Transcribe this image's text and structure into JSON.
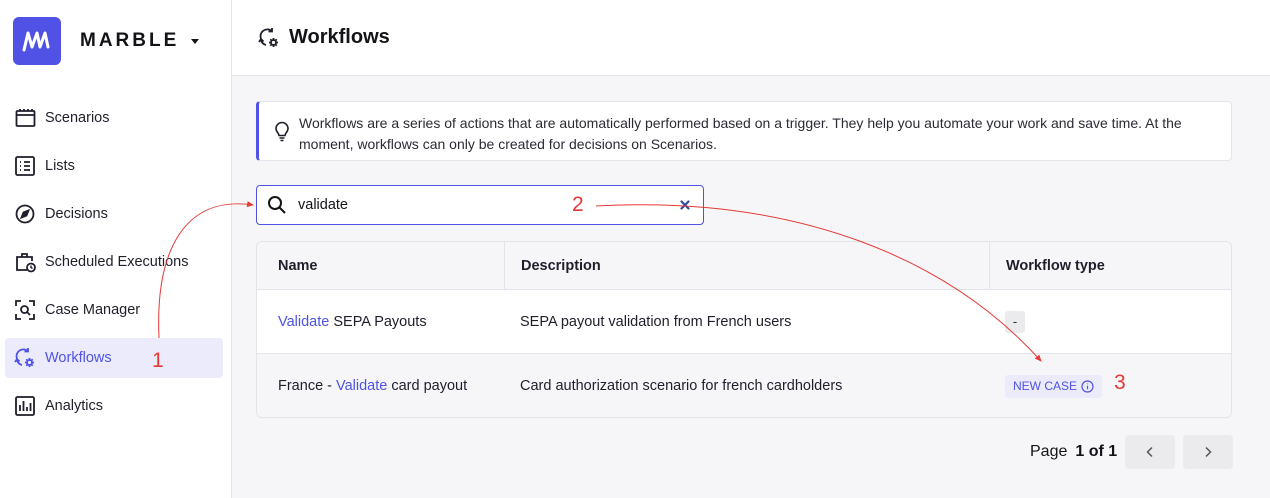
{
  "brand": {
    "name": "MARBLE"
  },
  "sidebar": {
    "items": [
      {
        "label": "Scenarios",
        "icon": "scenarios-icon"
      },
      {
        "label": "Lists",
        "icon": "list-icon"
      },
      {
        "label": "Decisions",
        "icon": "compass-icon"
      },
      {
        "label": "Scheduled Executions",
        "icon": "scheduled-icon"
      },
      {
        "label": "Case Manager",
        "icon": "case-manager-icon"
      },
      {
        "label": "Workflows",
        "icon": "workflow-icon",
        "active": true
      },
      {
        "label": "Analytics",
        "icon": "analytics-icon"
      }
    ]
  },
  "header": {
    "title": "Workflows",
    "icon": "workflow-icon"
  },
  "callout": {
    "text": "Workflows are a series of actions that are automatically performed based on a trigger. They help you automate your work and save time. At the moment, workflows can only be created for decisions on Scenarios."
  },
  "search": {
    "value": "validate"
  },
  "table": {
    "headers": {
      "name": "Name",
      "description": "Description",
      "type": "Workflow type"
    },
    "rows": [
      {
        "name_pre": "",
        "name_hl": "Validate",
        "name_post": " SEPA Payouts",
        "description": "SEPA payout validation from French users",
        "type": "-"
      },
      {
        "name_pre": "France - ",
        "name_hl": "Validate",
        "name_post": " card payout",
        "description": "Card authorization scenario for french cardholders",
        "type": "NEW CASE"
      }
    ]
  },
  "pagination": {
    "label": "Page",
    "count": "1 of 1"
  },
  "annotations": {
    "a1": "1",
    "a2": "2",
    "a3": "3"
  },
  "colors": {
    "accent": "#4f52e5",
    "annotation": "#e53935"
  }
}
